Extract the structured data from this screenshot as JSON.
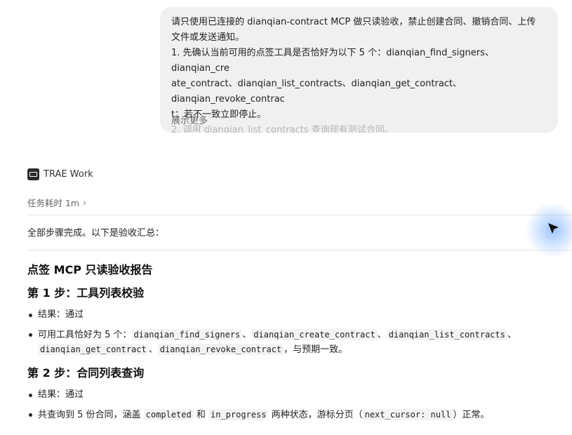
{
  "user_message": {
    "lines": [
      "请只使用已连接的 dianqian-contract MCP 做只读验收，禁止创建合同、撤销合同、上传",
      "文件或发送通知。",
      "1. 先确认当前可用的点签工具是否恰好为以下 5 个：dianqian_find_signers、dianqian_cre",
      "ate_contract、dianqian_list_contracts、dianqian_get_contract、dianqian_revoke_contrac",
      "t；若不一致立即停止。"
    ],
    "faded_line": "2. 调用 dianqian_list_contracts 查询现有测试合同。",
    "show_more": "展示更多"
  },
  "agent": {
    "icon": "trae-logo-icon",
    "name": "TRAE Work"
  },
  "elapsed": {
    "text": "任务耗时 1m",
    "chevron": "›"
  },
  "summary": "全部步骤完成。以下是验收汇总：",
  "report": {
    "title": "点签 MCP 只读验收报告",
    "step1": {
      "heading": "第 1 步：工具列表校验",
      "result": "结果：通过",
      "tools_prefix": "可用工具恰好为 5 个：",
      "tools": [
        "dianqian_find_signers",
        "dianqian_create_contract",
        "dianqian_list_contracts",
        "dianqian_get_contract",
        "dianqian_revoke_contract"
      ],
      "sep": "、",
      "tools_suffix": "，与预期一致。"
    },
    "step2": {
      "heading": "第 2 步：合同列表查询",
      "result": "结果：通过",
      "t1": "共查询到 5 份合同，涵盖 ",
      "c1": "completed",
      "t2": " 和 ",
      "c2": "in_progress",
      "t3": " 两种状态，游标分页（",
      "c3": "next_cursor: null",
      "t4": "）正常。"
    }
  }
}
